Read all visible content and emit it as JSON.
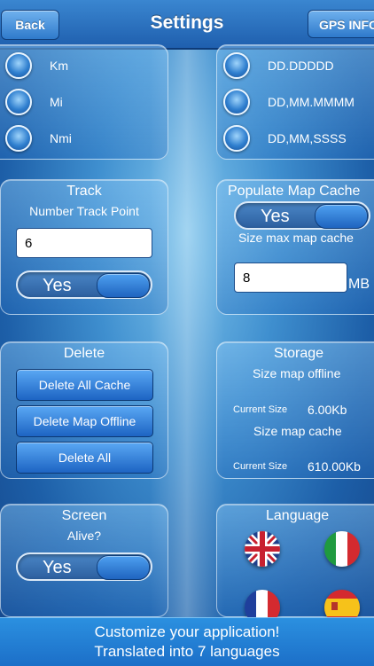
{
  "header": {
    "back_label": "Back",
    "title": "Settings",
    "gps_label": "GPS INFO"
  },
  "units": {
    "items": [
      {
        "label": "Km"
      },
      {
        "label": "Mi"
      },
      {
        "label": "Nmi"
      }
    ]
  },
  "coords": {
    "items": [
      {
        "label": "DD.DDDDD"
      },
      {
        "label": "DD,MM.MMMM"
      },
      {
        "label": "DD,MM,SSSS"
      }
    ]
  },
  "track": {
    "title": "Track",
    "subtitle": "Number Track Point",
    "value": "6",
    "toggle": "Yes"
  },
  "map_cache": {
    "title": "Populate Map Cache",
    "toggle": "Yes",
    "subtitle": "Size max map cache",
    "value": "8",
    "unit": "MB"
  },
  "delete": {
    "title": "Delete",
    "buttons": [
      "Delete All Cache",
      "Delete Map Offline",
      "Delete All"
    ]
  },
  "storage": {
    "title": "Storage",
    "offline_label": "Size map offline",
    "current_size_label": "Current Size",
    "offline_value": "6.00Kb",
    "cache_label": "Size map cache",
    "cache_value": "610.00Kb"
  },
  "screen": {
    "title": "Screen",
    "subtitle": "Alive?",
    "toggle": "Yes"
  },
  "language": {
    "title": "Language",
    "flags": [
      "uk-flag-icon",
      "italy-flag-icon",
      "france-flag-icon",
      "spain-flag-icon"
    ]
  },
  "footer": {
    "line1": "Customize your application!",
    "line2": "Translated into 7 languages"
  }
}
